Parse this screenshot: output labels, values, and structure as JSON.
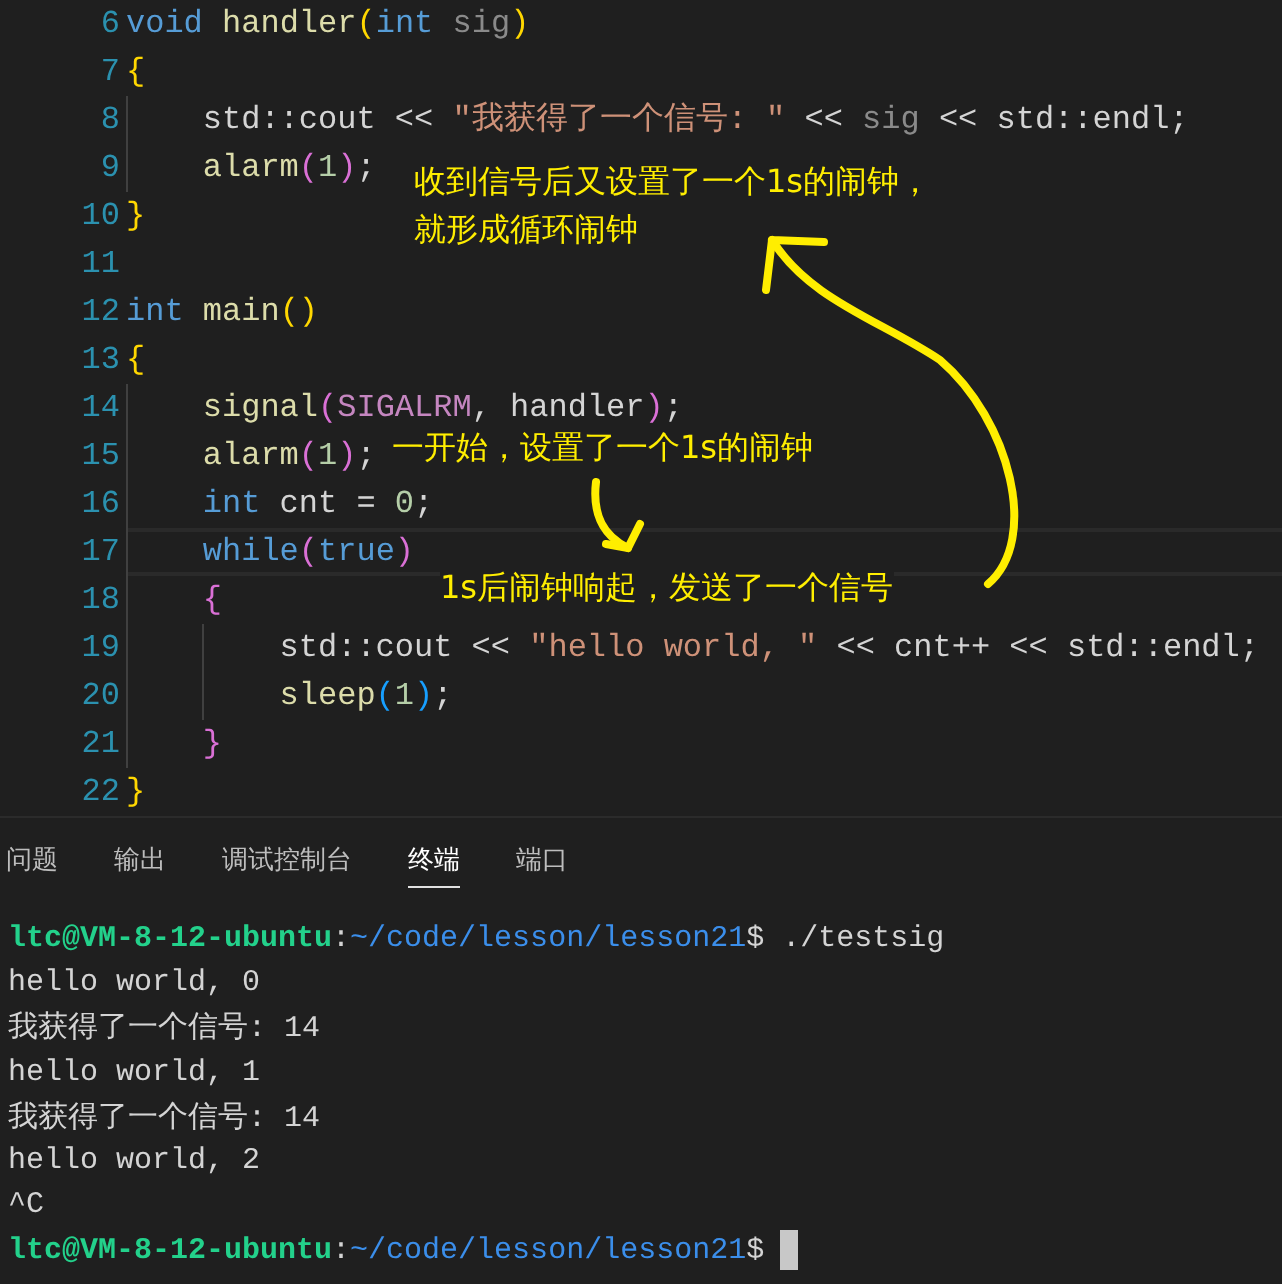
{
  "code": {
    "lines": [
      {
        "n": "6",
        "tokens": [
          {
            "t": "void ",
            "kind": "kw"
          },
          {
            "t": "handler",
            "kind": "fn"
          },
          {
            "t": "(",
            "kind": "b1"
          },
          {
            "t": "int ",
            "kind": "kw"
          },
          {
            "t": "sig",
            "kind": "dim"
          },
          {
            "t": ")",
            "kind": "b1"
          }
        ]
      },
      {
        "n": "7",
        "tokens": [
          {
            "t": "{",
            "kind": "b1"
          }
        ],
        "children": [
          {
            "n": "8",
            "tokens": [
              {
                "t": "std::cout << ",
                "kind": "p"
              },
              {
                "t": "\"我获得了一个信号: \"",
                "kind": "str"
              },
              {
                "t": " << ",
                "kind": "p"
              },
              {
                "t": "sig",
                "kind": "dim"
              },
              {
                "t": " << std::endl;",
                "kind": "p"
              }
            ]
          },
          {
            "n": "9",
            "tokens": [
              {
                "t": "alarm",
                "kind": "fn"
              },
              {
                "t": "(",
                "kind": "b2"
              },
              {
                "t": "1",
                "kind": "num"
              },
              {
                "t": ")",
                "kind": "b2"
              },
              {
                "t": ";",
                "kind": "p"
              }
            ]
          }
        ]
      },
      {
        "n": "10",
        "tokens": [
          {
            "t": "}",
            "kind": "b1"
          }
        ]
      },
      {
        "n": "11"
      },
      {
        "n": "12",
        "tokens": [
          {
            "t": "int ",
            "kind": "kw"
          },
          {
            "t": "main",
            "kind": "fn"
          },
          {
            "t": "()",
            "kind": "b1"
          }
        ]
      },
      {
        "n": "13",
        "tokens": [
          {
            "t": "{",
            "kind": "b1"
          }
        ],
        "children": [
          {
            "n": "14",
            "tokens": [
              {
                "t": "signal",
                "kind": "fn"
              },
              {
                "t": "(",
                "kind": "b2"
              },
              {
                "t": "SIGALRM",
                "kind": "mac"
              },
              {
                "t": ", handler",
                "kind": "p"
              },
              {
                "t": ")",
                "kind": "b2"
              },
              {
                "t": ";",
                "kind": "p"
              }
            ]
          },
          {
            "n": "15",
            "tokens": [
              {
                "t": "alarm",
                "kind": "fn"
              },
              {
                "t": "(",
                "kind": "b2"
              },
              {
                "t": "1",
                "kind": "num"
              },
              {
                "t": ")",
                "kind": "b2"
              },
              {
                "t": ";",
                "kind": "p"
              }
            ]
          },
          {
            "n": "16",
            "tokens": [
              {
                "t": "int ",
                "kind": "kw"
              },
              {
                "t": "cnt = ",
                "kind": "p"
              },
              {
                "t": "0",
                "kind": "num"
              },
              {
                "t": ";",
                "kind": "p"
              }
            ]
          },
          {
            "n": "17",
            "current": true,
            "tokens": [
              {
                "t": "while",
                "kind": "kw"
              },
              {
                "t": "(",
                "kind": "b2"
              },
              {
                "t": "true",
                "kind": "kw"
              },
              {
                "t": ")",
                "kind": "b2"
              }
            ]
          },
          {
            "n": "18",
            "tokens": [
              {
                "t": "{",
                "kind": "b2"
              }
            ],
            "children": [
              {
                "n": "19",
                "tokens": [
                  {
                    "t": "std::cout << ",
                    "kind": "p"
                  },
                  {
                    "t": "\"hello world, \"",
                    "kind": "str"
                  },
                  {
                    "t": " << cnt++ << std::endl;",
                    "kind": "p"
                  }
                ]
              },
              {
                "n": "20",
                "tokens": [
                  {
                    "t": "sleep",
                    "kind": "fn"
                  },
                  {
                    "t": "(",
                    "kind": "b3"
                  },
                  {
                    "t": "1",
                    "kind": "num"
                  },
                  {
                    "t": ")",
                    "kind": "b3"
                  },
                  {
                    "t": ";",
                    "kind": "p"
                  }
                ]
              }
            ]
          },
          {
            "n": "21",
            "tokens": [
              {
                "t": "}",
                "kind": "b2"
              }
            ]
          }
        ]
      },
      {
        "n": "22",
        "tokens": [
          {
            "t": "}",
            "kind": "b1"
          }
        ]
      }
    ]
  },
  "annotations": [
    {
      "lines": [
        "收到信号后又设置了一个1s的闹钟，",
        "就形成循环闹钟"
      ]
    },
    {
      "lines": [
        "一开始，设置了一个1s的闹钟"
      ]
    },
    {
      "lines": [
        "1s后闹钟响起，发送了一个信号"
      ]
    }
  ],
  "panel_tabs": [
    {
      "label": "问题",
      "selected": false
    },
    {
      "label": "输出",
      "selected": false
    },
    {
      "label": "调试控制台",
      "selected": false
    },
    {
      "label": "终端",
      "selected": true
    },
    {
      "label": "端口",
      "selected": false
    }
  ],
  "terminal": [
    {
      "segs": [
        {
          "t": "ltc@VM-8-12-ubuntu",
          "kind": "user"
        },
        {
          "t": ":",
          "kind": "p"
        },
        {
          "t": "~/code/lesson/lesson21",
          "kind": "path"
        },
        {
          "t": "$ ./testsig",
          "kind": "p"
        }
      ]
    },
    {
      "segs": [
        {
          "t": "hello world, 0",
          "kind": "p"
        }
      ]
    },
    {
      "segs": [
        {
          "t": "我获得了一个信号: 14",
          "kind": "p"
        }
      ]
    },
    {
      "segs": [
        {
          "t": "hello world, 1",
          "kind": "p"
        }
      ]
    },
    {
      "segs": [
        {
          "t": "我获得了一个信号: 14",
          "kind": "p"
        }
      ]
    },
    {
      "segs": [
        {
          "t": "hello world, 2",
          "kind": "p"
        }
      ]
    },
    {
      "segs": [
        {
          "t": "^C",
          "kind": "p"
        }
      ]
    },
    {
      "cursor": true,
      "segs": [
        {
          "t": "ltc@VM-8-12-ubuntu",
          "kind": "user"
        },
        {
          "t": ":",
          "kind": "p"
        },
        {
          "t": "~/code/lesson/lesson21",
          "kind": "path"
        },
        {
          "t": "$",
          "kind": "p"
        }
      ]
    }
  ]
}
